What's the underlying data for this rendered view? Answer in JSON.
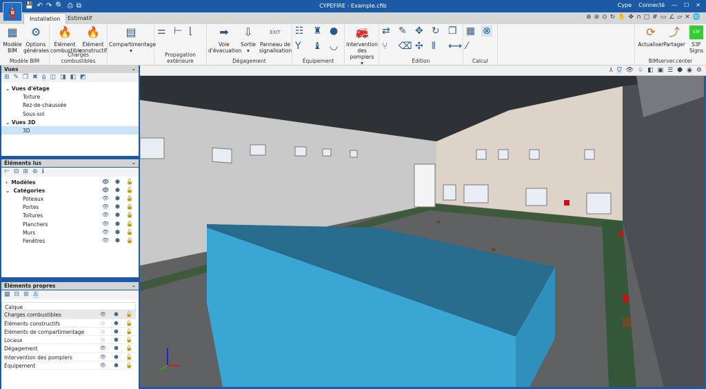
{
  "title": "CYPEFIRE - Example.cfib",
  "titlebar": {
    "user": "Cype",
    "status": "Connecté",
    "minimize": "—",
    "maximize": "☐",
    "close": "✕"
  },
  "tabs": [
    {
      "label": "Installation",
      "active": true
    },
    {
      "label": "Estimatif",
      "active": false
    }
  ],
  "ribbon": {
    "groups": [
      {
        "label": "Modèle BIM",
        "buttons": [
          "Modèle BIM",
          "Options générales"
        ]
      },
      {
        "label": "Charges combustibles",
        "buttons": [
          "Élément combustible",
          "Élément constructif"
        ]
      },
      {
        "label": "",
        "buttons": [
          "Compartimentage"
        ]
      },
      {
        "label": "Propagation extérieure",
        "buttons": []
      },
      {
        "label": "Dégagement",
        "buttons": [
          "Voie d'évacuation",
          "Sortie",
          "Panneau de signalisation"
        ]
      },
      {
        "label": "Équipement",
        "buttons": []
      },
      {
        "label": "",
        "buttons": [
          "Intervention des pompiers"
        ]
      },
      {
        "label": "Édition",
        "buttons": []
      },
      {
        "label": "Calcul",
        "buttons": []
      },
      {
        "label": "BIMserver.center",
        "buttons": [
          "Actualiser",
          "Partager",
          "S3F Signs"
        ]
      }
    ]
  },
  "vues": {
    "title": "Vues",
    "groups": [
      {
        "label": "Vues d'étage",
        "items": [
          "Toiture",
          "Rez-de-chaussée",
          "Sous-sol"
        ]
      },
      {
        "label": "Vues 3D",
        "items": [
          "3D"
        ]
      }
    ],
    "selected": "3D"
  },
  "elements_lus": {
    "title": "Éléments lus",
    "roots": [
      "Modèles",
      "Catégories"
    ],
    "categories": [
      "Poteaux",
      "Portes",
      "Toitures",
      "Planchers",
      "Murs",
      "Fenêtres"
    ]
  },
  "elements_propres": {
    "title": "Éléments propres",
    "column": "Calque",
    "layers": [
      {
        "name": "Charges combustibles",
        "visible": true
      },
      {
        "name": "Éléments constructifs",
        "visible": false
      },
      {
        "name": "Éléments de compartimentage",
        "visible": false
      },
      {
        "name": "Locaux",
        "visible": false
      },
      {
        "name": "Dégagement",
        "visible": true
      },
      {
        "name": "Intervention des pompiers",
        "visible": true
      },
      {
        "name": "Équipement",
        "visible": true
      }
    ]
  },
  "colors": {
    "titlebar": "#1c5aa6",
    "accent_blue_box": "#3aa6d4",
    "selection": "#cce4f7"
  }
}
